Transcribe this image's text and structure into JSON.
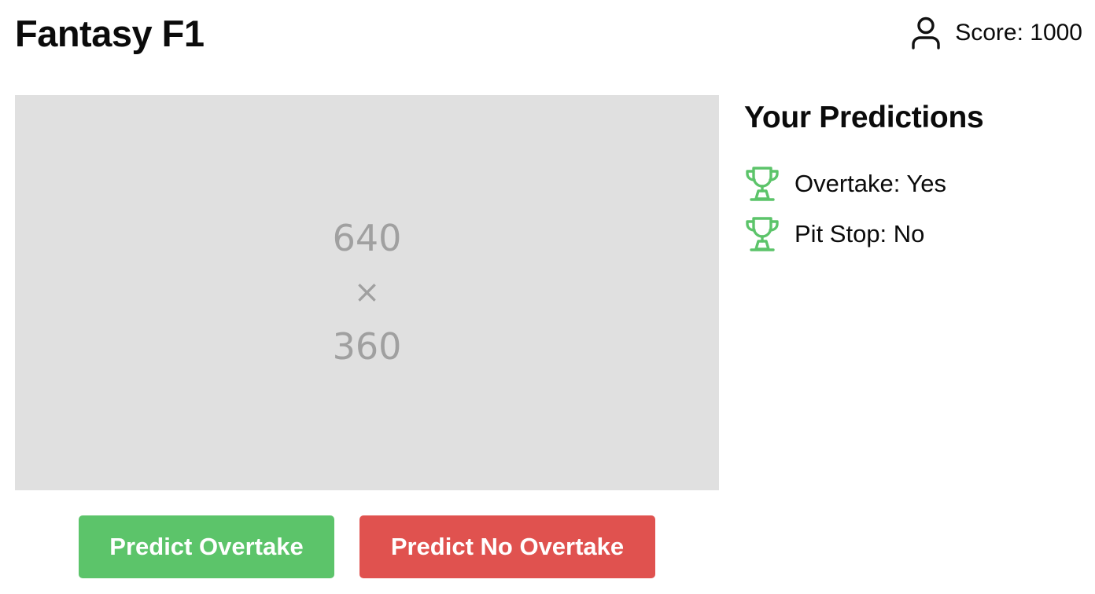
{
  "header": {
    "title": "Fantasy F1",
    "user_icon": "user-icon",
    "score_text": "Score: 1000"
  },
  "video": {
    "placeholder_width": "640",
    "placeholder_times": "×",
    "placeholder_height": "360"
  },
  "actions": {
    "predict_overtake": "Predict Overtake",
    "predict_no_overtake": "Predict No Overtake"
  },
  "predictions": {
    "title": "Your Predictions",
    "items": [
      {
        "icon": "trophy-icon",
        "text": "Overtake: Yes"
      },
      {
        "icon": "trophy-icon",
        "text": "Pit Stop: No"
      }
    ]
  },
  "colors": {
    "success": "#5cc46a",
    "danger": "#e0524f",
    "placeholder_bg": "#e0e0e0",
    "placeholder_text": "#a0a0a0"
  }
}
